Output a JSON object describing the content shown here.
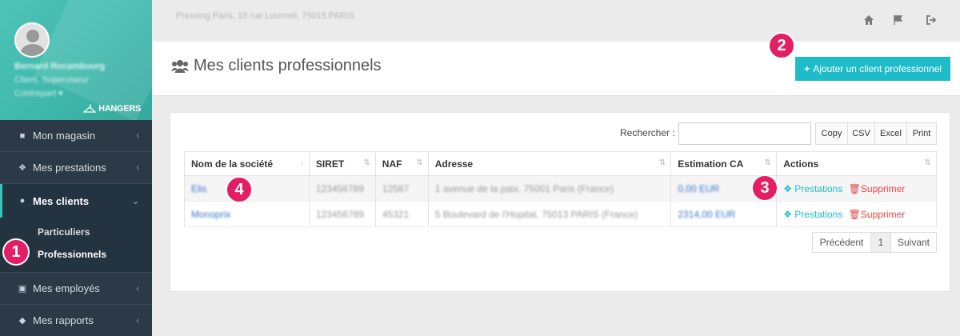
{
  "sidebar": {
    "profile": {
      "name": "Bernard Rocambourg",
      "role": "Client, Superviseur",
      "role2": "Contrepart ▾",
      "logo": "HANGERS"
    },
    "items": [
      {
        "label": "Mon magasin",
        "icon": "briefcase-icon"
      },
      {
        "label": "Mes prestations",
        "icon": "cubes-icon"
      },
      {
        "label": "Mes clients",
        "icon": "users-icon"
      },
      {
        "label": "Mes employés",
        "icon": "id-card-icon"
      },
      {
        "label": "Mes rapports",
        "icon": "tags-icon"
      }
    ],
    "submenu": [
      "Particuliers",
      "Professionnels"
    ]
  },
  "topbar": {
    "address": "Pressing Paris, 15 rue Lourmel, 75015 PARIS",
    "icons": [
      "home-icon",
      "flag-icon",
      "sign-out-icon"
    ]
  },
  "header": {
    "title": "Mes clients professionnels",
    "add_button": "Ajouter un client professionnel"
  },
  "table": {
    "search_label": "Rechercher :",
    "export_buttons": [
      "Copy",
      "CSV",
      "Excel",
      "Print"
    ],
    "columns": [
      "Nom de la société",
      "SIRET",
      "NAF",
      "Adresse",
      "Estimation CA",
      "Actions"
    ],
    "rows": [
      {
        "name": "Elis",
        "siret": "123456789",
        "naf": "12587",
        "adresse": "1 avenue de la paix, 75001 Paris (France)",
        "ca": "0,00 EUR",
        "prestations": "Prestations",
        "supprimer": "Supprimer"
      },
      {
        "name": "Monoprix",
        "siret": "123456789",
        "naf": "45321",
        "adresse": "5 Boulevard de l'Hopital, 75013 PARIS (France)",
        "ca": "2314,00 EUR",
        "prestations": "Prestations",
        "supprimer": "Supprimer"
      }
    ],
    "pagination": {
      "prev": "Précédent",
      "page": "1",
      "next": "Suivant"
    }
  },
  "badges": [
    "1",
    "2",
    "3",
    "4"
  ],
  "colors": {
    "accent": "#1ebcc9",
    "sidebar": "#2c3a47",
    "badge": "#e31e64",
    "danger": "#e04848"
  }
}
